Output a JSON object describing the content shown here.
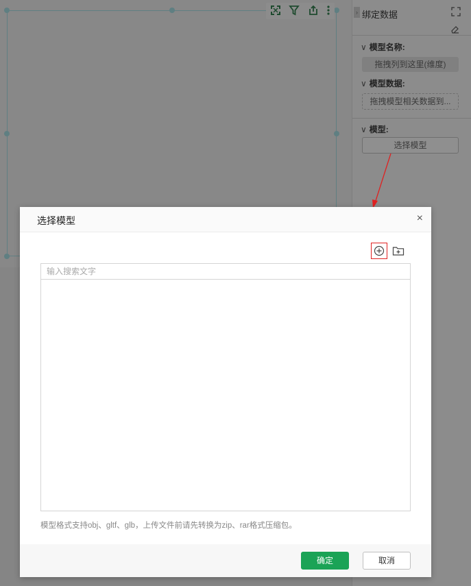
{
  "panel": {
    "title": "绑定数据",
    "model_name_label": "模型名称:",
    "model_name_drop": "拖拽列到这里(维度)",
    "model_data_label": "模型数据:",
    "model_data_drop": "拖拽模型相关数据到...",
    "model_label": "模型:",
    "select_model_button": "选择模型"
  },
  "modal": {
    "title": "选择模型",
    "close_glyph": "×",
    "search_placeholder": "输入搜索文字",
    "hint": "模型格式支持obj、gltf、glb，上传文件前请先转换为zip、rar格式压缩包。",
    "ok_label": "确定",
    "cancel_label": "取消"
  },
  "colors": {
    "primary": "#1ba356",
    "annotation": "#e02020",
    "selection": "#5f7f82"
  },
  "icons": [
    "expand-icon",
    "filter-icon",
    "export-icon",
    "more-icon",
    "fullscreen-icon",
    "eraser-icon",
    "add-circle-icon",
    "folder-add-icon",
    "close-icon"
  ]
}
